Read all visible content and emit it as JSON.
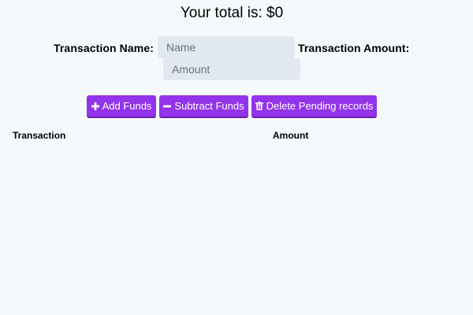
{
  "header": {
    "total_text": "Your total is: $0"
  },
  "form": {
    "name_label": "Transaction Name:",
    "amount_label": "Transaction Amount:",
    "name_placeholder": "Name",
    "amount_placeholder": "Amount"
  },
  "buttons": {
    "add_label": "Add Funds",
    "add_icon": "plus-icon",
    "subtract_label": "Subtract Funds",
    "subtract_icon": "minus-icon",
    "delete_label": "Delete Pending records",
    "delete_icon": "trash-icon",
    "color": "#9333ea"
  },
  "table": {
    "columns": [
      "Transaction",
      "Amount"
    ],
    "rows": []
  }
}
